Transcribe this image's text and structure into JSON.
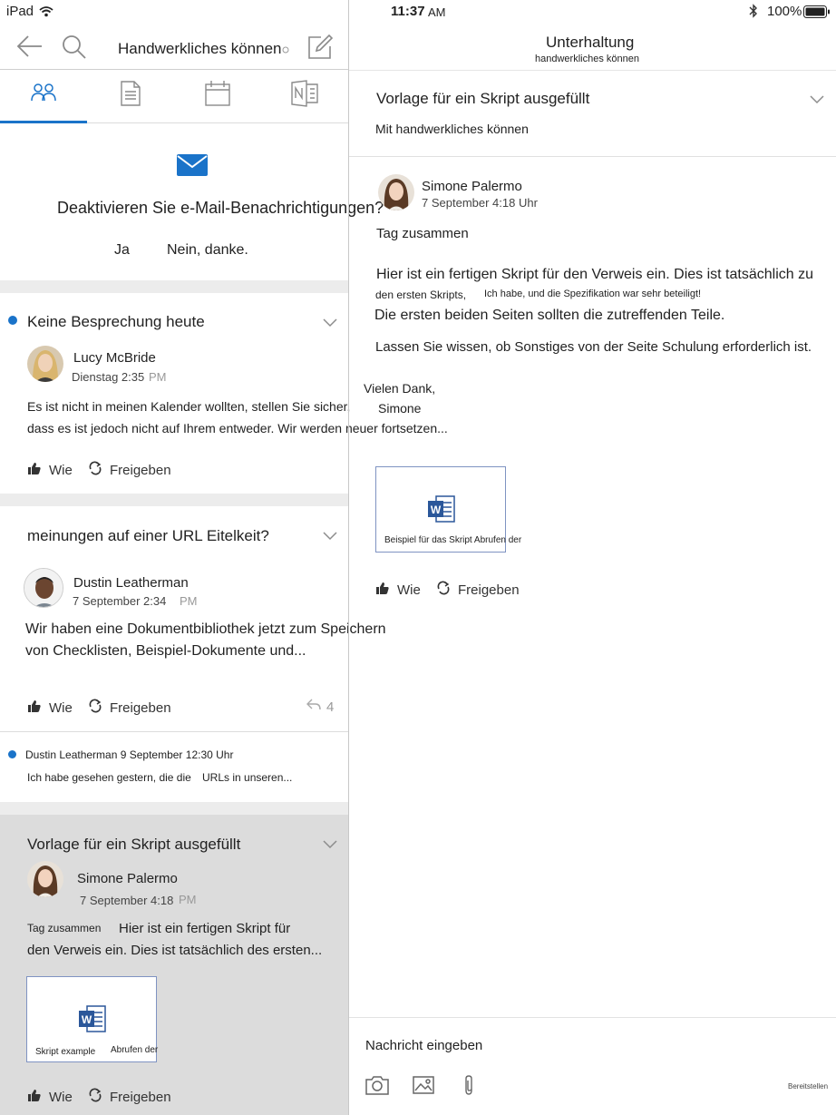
{
  "status_bar": {
    "device": "iPad",
    "time": "11:37",
    "ampm": "AM",
    "battery": "100%"
  },
  "left_header": {
    "group_title": "Handwerkliches können",
    "tabs": [
      {
        "icon": "people-icon",
        "active": true
      },
      {
        "icon": "document-icon",
        "active": false
      },
      {
        "icon": "calendar-icon",
        "active": false
      },
      {
        "icon": "onenote-icon",
        "active": false
      }
    ],
    "accent": "#1a73c9"
  },
  "email_prompt": {
    "question": "Deaktivieren Sie e-Mail-Benachrichtigungen?",
    "yes": "Ja",
    "no": "Nein, danke."
  },
  "feed": [
    {
      "title": "Keine Besprechung heute",
      "author": "Lucy McBride",
      "date": "Dienstag 2:35",
      "ampm": "PM",
      "body1": "Es ist nicht in meinen Kalender wollten, stellen Sie sicher,",
      "body2": "dass es ist jedoch nicht auf Ihrem entweder. Wir werden neuer fortsetzen...",
      "like": "Wie",
      "share": "Freigeben"
    },
    {
      "title": "meinungen auf einer URL Eitelkeit?",
      "author": "Dustin Leatherman",
      "date": "7 September 2:34",
      "ampm": "PM",
      "body1": "Wir haben eine Dokumentbibliothek jetzt zum Speichern",
      "body2": "von Checklisten, Beispiel-Dokumente und...",
      "like": "Wie",
      "share": "Freigeben",
      "reply_count": "4"
    },
    {
      "line1": "Dustin Leatherman 9 September 12:30 Uhr",
      "line2a": "Ich habe gesehen gestern, die die",
      "line2b": "URLs in unseren..."
    },
    {
      "title": "Vorlage für ein Skript ausgefüllt",
      "author": "Simone Palermo",
      "date": "7 September 4:18",
      "ampm": "PM",
      "body1a": "Tag zusammen",
      "body1b": "Hier ist ein fertigen Skript für",
      "body2": "den Verweis ein. Dies ist tatsächlich des ersten...",
      "attachment_a": "Skript example",
      "attachment_b": "Abrufen der",
      "like": "Wie",
      "share": "Freigeben"
    }
  ],
  "conversation": {
    "header_title": "Unterhaltung",
    "header_subtitle": "handwerkliches können",
    "subject": "Vorlage für ein Skript ausgefüllt",
    "with_group": "Mit handwerkliches können",
    "author": "Simone Palermo",
    "date": "7 September 4:18 Uhr",
    "greeting": "Tag zusammen",
    "p1": "Hier ist ein fertigen Skript für den Verweis ein. Dies ist tatsächlich zu",
    "p1b_a": "den ersten Skripts,",
    "p1b_b": "Ich habe, und die Spezifikation war sehr beteiligt!",
    "p2": "Die ersten beiden Seiten sollten die zutreffenden Teile.",
    "p3": "Lassen Sie wissen, ob Sonstiges von der Seite Schulung erforderlich ist.",
    "signoff": "Vielen Dank,",
    "signname": "Simone",
    "attachment": "Beispiel für das Skript Abrufen der",
    "like": "Wie",
    "share": "Freigeben"
  },
  "composer": {
    "placeholder": "Nachricht eingeben",
    "send": "Bereitstellen"
  }
}
